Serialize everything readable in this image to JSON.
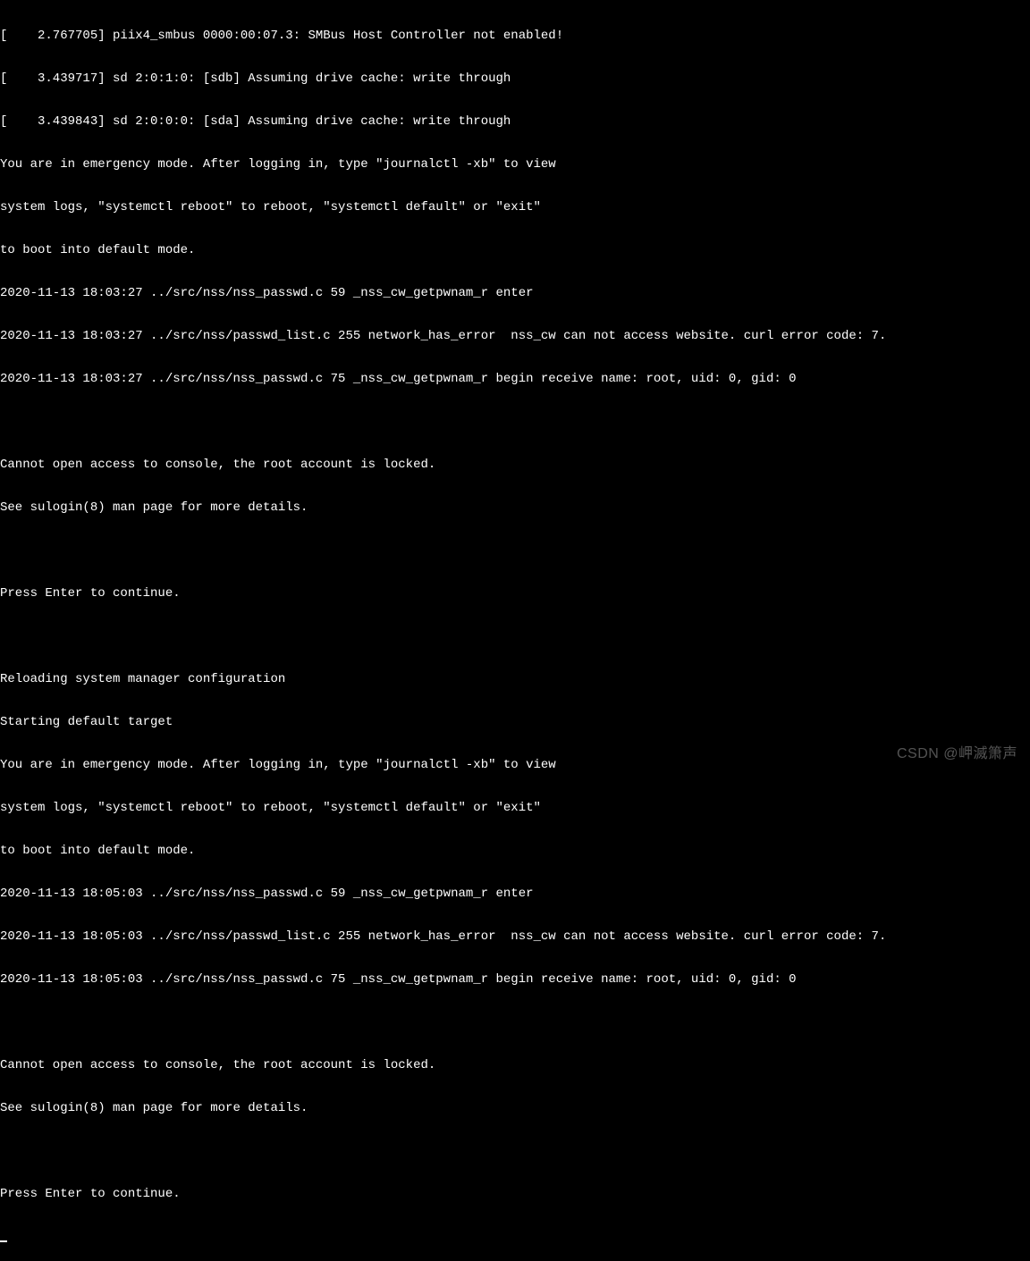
{
  "console": {
    "lines": [
      "[    2.767705] piix4_smbus 0000:00:07.3: SMBus Host Controller not enabled!",
      "[    3.439717] sd 2:0:1:0: [sdb] Assuming drive cache: write through",
      "[    3.439843] sd 2:0:0:0: [sda] Assuming drive cache: write through",
      "You are in emergency mode. After logging in, type \"journalctl -xb\" to view",
      "system logs, \"systemctl reboot\" to reboot, \"systemctl default\" or \"exit\"",
      "to boot into default mode.",
      "2020-11-13 18:03:27 ../src/nss/nss_passwd.c 59 _nss_cw_getpwnam_r enter",
      "2020-11-13 18:03:27 ../src/nss/passwd_list.c 255 network_has_error  nss_cw can not access website. curl error code: 7.",
      "2020-11-13 18:03:27 ../src/nss/nss_passwd.c 75 _nss_cw_getpwnam_r begin receive name: root, uid: 0, gid: 0",
      "",
      "Cannot open access to console, the root account is locked.",
      "See sulogin(8) man page for more details.",
      "",
      "Press Enter to continue.",
      "",
      "Reloading system manager configuration",
      "Starting default target",
      "You are in emergency mode. After logging in, type \"journalctl -xb\" to view",
      "system logs, \"systemctl reboot\" to reboot, \"systemctl default\" or \"exit\"",
      "to boot into default mode.",
      "2020-11-13 18:05:03 ../src/nss/nss_passwd.c 59 _nss_cw_getpwnam_r enter",
      "2020-11-13 18:05:03 ../src/nss/passwd_list.c 255 network_has_error  nss_cw can not access website. curl error code: 7.",
      "2020-11-13 18:05:03 ../src/nss/nss_passwd.c 75 _nss_cw_getpwnam_r begin receive name: root, uid: 0, gid: 0",
      "",
      "Cannot open access to console, the root account is locked.",
      "See sulogin(8) man page for more details.",
      "",
      "Press Enter to continue."
    ]
  },
  "watermark": "CSDN @岬滅箫声"
}
